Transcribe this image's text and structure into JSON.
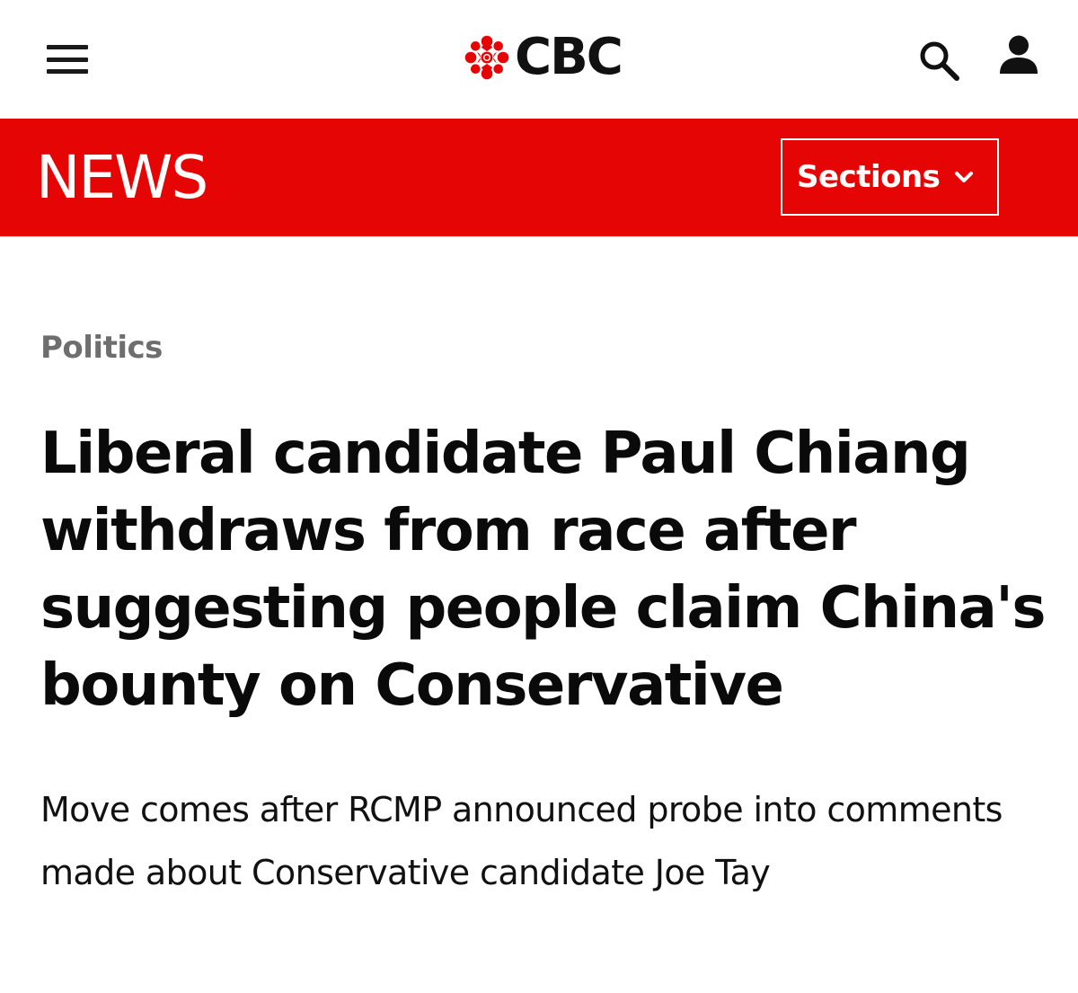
{
  "header": {
    "brand": "CBC",
    "menu_icon": "hamburger-menu-icon",
    "search_icon": "search-icon",
    "account_icon": "user-account-icon",
    "brand_color": "#e60505"
  },
  "section_bar": {
    "title": "NEWS",
    "sections_label": "Sections",
    "sections_icon": "chevron-down-icon"
  },
  "article": {
    "category": "Politics",
    "headline": "Liberal candidate Paul Chiang withdraws from race after suggesting people claim China's bounty on Conservative",
    "dek": "Move comes after RCMP announced probe into comments made about Conservative candidate Joe Tay"
  }
}
